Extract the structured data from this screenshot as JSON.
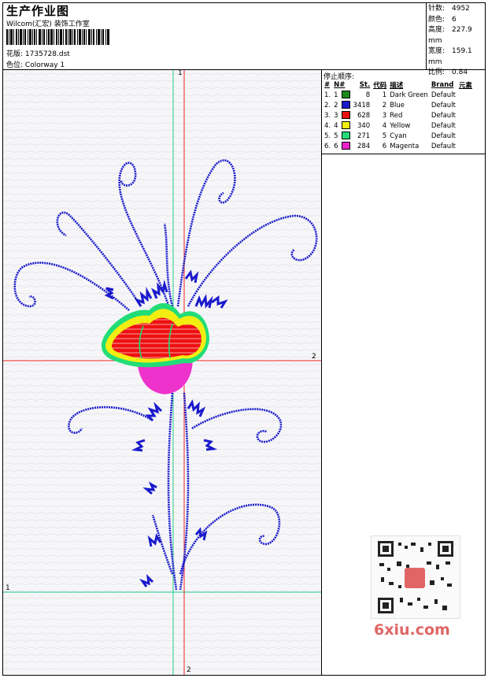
{
  "header": {
    "title": "生产作业图",
    "subtitle": "Wilcom(汇宏) 装饰工作室",
    "design_label": "花版:",
    "design_file": "1735728.dst",
    "colorway_label": "色位:",
    "colorway": "Colorway 1"
  },
  "stats": [
    {
      "key": "针数:",
      "value": "4952"
    },
    {
      "key": "颜色:",
      "value": "6"
    },
    {
      "key": "高度:",
      "value": "227.9 mm"
    },
    {
      "key": "宽度:",
      "value": "159.1 mm"
    },
    {
      "key": "比例:",
      "value": "0.84"
    }
  ],
  "stoplist": {
    "heading": "停止顺序:",
    "columns": [
      "#",
      "N#",
      "St.",
      "代码",
      "描述",
      "Brand",
      "元素"
    ],
    "rows": [
      {
        "idx": "1.",
        "n": "1",
        "color": "#1a8a1a",
        "st": "8",
        "code": "1",
        "desc": "Dark Green",
        "brand": "Default"
      },
      {
        "idx": "2.",
        "n": "2",
        "color": "#1a1acc",
        "st": "3418",
        "code": "2",
        "desc": "Blue",
        "brand": "Default"
      },
      {
        "idx": "3.",
        "n": "3",
        "color": "#ee1111",
        "st": "628",
        "code": "3",
        "desc": "Red",
        "brand": "Default"
      },
      {
        "idx": "4.",
        "n": "4",
        "color": "#f2ee11",
        "st": "340",
        "code": "4",
        "desc": "Yellow",
        "brand": "Default"
      },
      {
        "idx": "5.",
        "n": "5",
        "color": "#22dd77",
        "st": "271",
        "code": "5",
        "desc": "Cyan",
        "brand": "Default"
      },
      {
        "idx": "6.",
        "n": "6",
        "color": "#ee22cc",
        "st": "284",
        "code": "6",
        "desc": "Magenta",
        "brand": "Default"
      }
    ]
  },
  "guides": {
    "v_red_top": "1",
    "h_red_right": "2",
    "h_green_left": "1",
    "v_red_bottom": "2"
  },
  "watermark": {
    "site": "6xiu.com"
  }
}
